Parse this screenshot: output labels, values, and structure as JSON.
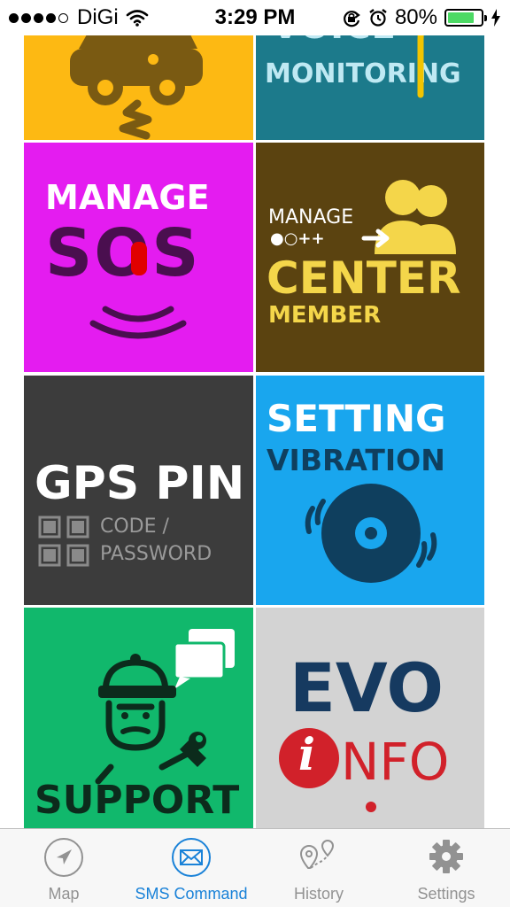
{
  "status_bar": {
    "carrier": "DiGi",
    "time": "3:29 PM",
    "battery_percent": "80%",
    "battery_level": 0.8,
    "signal_bars_filled": 4,
    "signal_bars_total": 5
  },
  "tiles": {
    "voice": {
      "line1": "VOICE",
      "line2": "MONITORING"
    },
    "sos": {
      "line1": "MANAGE",
      "line2": "SOS"
    },
    "center": {
      "line1": "MANAGE",
      "line2": "CENTER",
      "line3": "MEMBER",
      "pattern": "●○++"
    },
    "gps": {
      "line1": "GPS PIN",
      "line2": "CODE /",
      "line3": "PASSWORD"
    },
    "vibration": {
      "line1": "SETTING",
      "line2": "VIBRATION"
    },
    "support": {
      "line1": "SUPPORT"
    },
    "evo": {
      "line1": "EVO",
      "line2": "NFO",
      "icon_letter": "i"
    }
  },
  "tab_bar": {
    "tabs": [
      {
        "label": "Map",
        "icon": "navigation-arrow-icon",
        "active": false
      },
      {
        "label": "SMS Command",
        "icon": "envelope-icon",
        "active": true
      },
      {
        "label": "History",
        "icon": "map-pins-icon",
        "active": false
      },
      {
        "label": "Settings",
        "icon": "gear-icon",
        "active": false
      }
    ]
  },
  "colors": {
    "car_tile": "#fdb913",
    "voice_tile": "#1c7a8b",
    "sos_tile": "#e41cf0",
    "center_tile": "#5b4310",
    "gps_tile": "#3c3c3c",
    "vibration_tile": "#19a6ee",
    "support_tile": "#11b86c",
    "evo_tile": "#d3d3d3",
    "tab_active": "#1a82d8",
    "tab_inactive": "#929292"
  }
}
